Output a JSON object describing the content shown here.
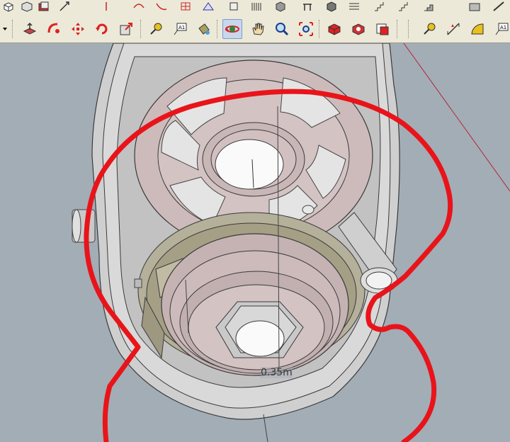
{
  "toolbar": {
    "top_icons": [
      "box-icon",
      "box-open-icon",
      "folder-icon",
      "rotate-view-icon",
      "line-icon",
      "arc-icon",
      "curve-icon",
      "grid-icon",
      "book-icon",
      "shape-icon",
      "cylinder-icon",
      "cube-icon",
      "table-icon",
      "solid-icon",
      "tree-icon",
      "stairs-icon",
      "stairs-alt-icon",
      "stairs-fill-icon",
      "brick-icon",
      "wall-icon"
    ],
    "main_buttons": [
      {
        "name": "push-pull-icon"
      },
      {
        "name": "follow-me-icon"
      },
      {
        "name": "move-icon"
      },
      {
        "name": "rotate-icon"
      },
      {
        "name": "scale-icon"
      },
      {
        "name": "tape-measure-icon"
      },
      {
        "name": "text-icon",
        "label": "A1"
      },
      {
        "name": "paint-bucket-icon"
      },
      {
        "name": "orbit-icon",
        "active": true
      },
      {
        "name": "pan-icon"
      },
      {
        "name": "zoom-icon"
      },
      {
        "name": "zoom-extents-icon"
      },
      {
        "name": "components-icon"
      },
      {
        "name": "materials-icon"
      },
      {
        "name": "styles-icon"
      },
      {
        "name": "tape-measure-alt-icon"
      },
      {
        "name": "dimension-icon"
      },
      {
        "name": "protractor-icon"
      },
      {
        "name": "axes-icon",
        "label": "A1"
      }
    ]
  },
  "viewport": {
    "dimension_label": "0.35m",
    "background": "#a3adb6",
    "annotation_color": "#e8141a"
  }
}
